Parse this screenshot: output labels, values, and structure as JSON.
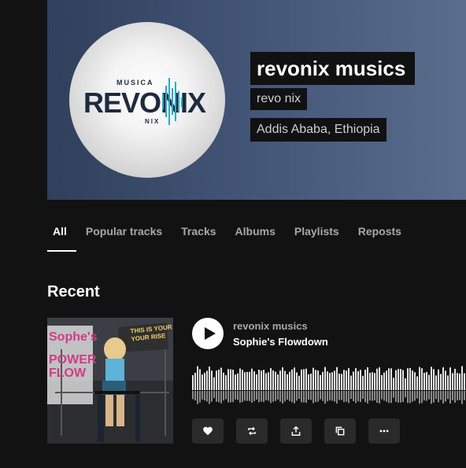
{
  "header": {
    "title": "revonix musics",
    "username": "revo nix",
    "location": "Addis Ababa, Ethiopia"
  },
  "logo": {
    "top_text": "MUSICA",
    "main_text": "REVONIX",
    "bottom_text": "NIX"
  },
  "tabs": [
    {
      "label": "All",
      "active": true
    },
    {
      "label": "Popular tracks",
      "active": false
    },
    {
      "label": "Tracks",
      "active": false
    },
    {
      "label": "Albums",
      "active": false
    },
    {
      "label": "Playlists",
      "active": false
    },
    {
      "label": "Reposts",
      "active": false
    }
  ],
  "recent": {
    "title": "Recent",
    "track": {
      "artist": "revonix musics",
      "title": "Sophie's Flowdown",
      "cover": {
        "wall_text_left": "Sophe's",
        "wall_text_left2": "POWER",
        "wall_text_left3": "FLOW",
        "banner_line1": "THIS IS YOUR",
        "banner_line2": "YOUR RISE"
      },
      "actions": [
        {
          "icon": "heart-icon"
        },
        {
          "icon": "repost-icon"
        },
        {
          "icon": "share-icon"
        },
        {
          "icon": "copy-icon"
        },
        {
          "icon": "more-icon"
        }
      ]
    }
  },
  "colors": {
    "background": "#121212",
    "hero_start": "#2f3f5c",
    "hero_end": "#5b6d8c",
    "muted_text": "#a7a7a7",
    "button_bg": "#2a2a2a"
  }
}
